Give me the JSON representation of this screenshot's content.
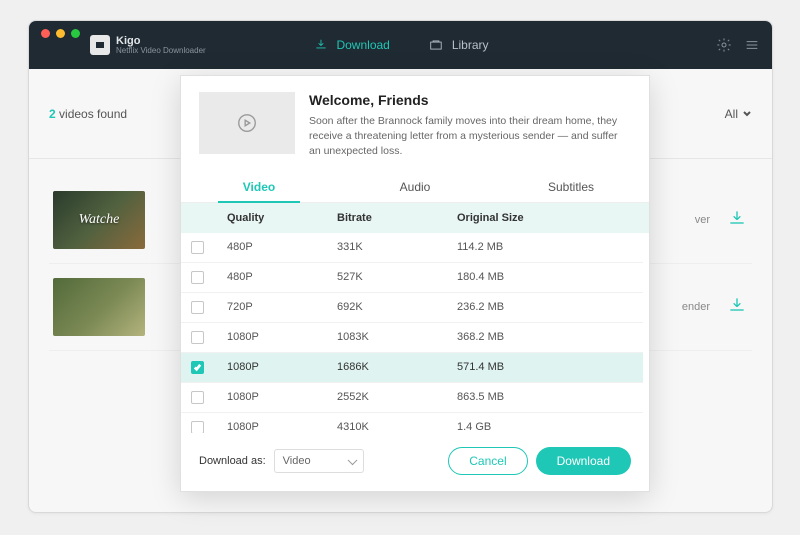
{
  "brand": {
    "name": "Kigo",
    "subtitle": "Netflix Video Downloader"
  },
  "nav": {
    "download": "Download",
    "library": "Library"
  },
  "search": {
    "count": "2",
    "found_label": "videos found",
    "filter": "All"
  },
  "rows": [
    {
      "thumb_text": "Watche",
      "meta": "ver"
    },
    {
      "thumb_text": "",
      "meta": "ender"
    }
  ],
  "modal": {
    "title": "Welcome, Friends",
    "description": "Soon after the Brannock family moves into their dream home, they receive a threatening letter from a mysterious sender — and suffer an unexpected loss.",
    "tabs": {
      "video": "Video",
      "audio": "Audio",
      "subtitles": "Subtitles"
    },
    "columns": {
      "quality": "Quality",
      "bitrate": "Bitrate",
      "size": "Original Size"
    },
    "options": [
      {
        "quality": "480P",
        "bitrate": "331K",
        "size": "114.2 MB",
        "checked": false
      },
      {
        "quality": "480P",
        "bitrate": "527K",
        "size": "180.4 MB",
        "checked": false
      },
      {
        "quality": "720P",
        "bitrate": "692K",
        "size": "236.2 MB",
        "checked": false
      },
      {
        "quality": "1080P",
        "bitrate": "1083K",
        "size": "368.2 MB",
        "checked": false
      },
      {
        "quality": "1080P",
        "bitrate": "1686K",
        "size": "571.4 MB",
        "checked": true
      },
      {
        "quality": "1080P",
        "bitrate": "2552K",
        "size": "863.5 MB",
        "checked": false
      },
      {
        "quality": "1080P",
        "bitrate": "4310K",
        "size": "1.4 GB",
        "checked": false
      }
    ],
    "download_as_label": "Download as:",
    "download_as_value": "Video",
    "cancel": "Cancel",
    "download": "Download"
  }
}
